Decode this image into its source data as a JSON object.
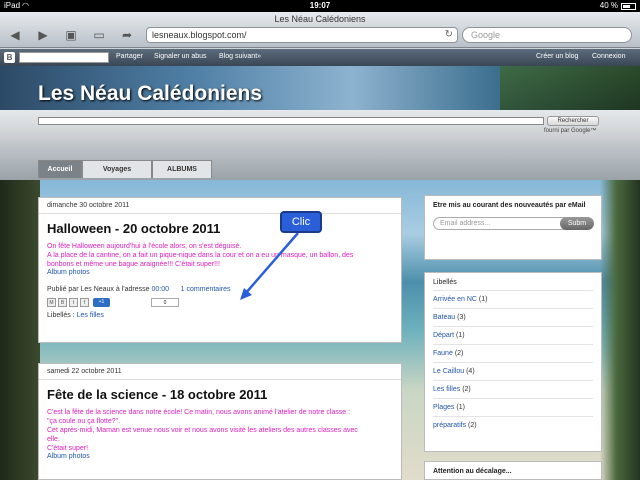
{
  "status_bar": {
    "carrier": "iPad",
    "time": "19:07",
    "battery": "40 %"
  },
  "browser": {
    "page_title": "Les Néau Calédoniens",
    "url": "lesneaux.blogspot.com/",
    "search_placeholder": "Google"
  },
  "navbar": {
    "logo": "B",
    "share": "Partager",
    "report": "Signaler un abus",
    "next_blog": "Blog suivant»",
    "create_blog": "Créer un blog",
    "signin": "Connexion"
  },
  "header": {
    "blog_title": "Les Néau Calédoniens",
    "search_button": "Rechercher",
    "search_credit": "fourni par Google™"
  },
  "tabs": [
    {
      "label": "Accueil",
      "active": true
    },
    {
      "label": "Voyages",
      "active": false
    },
    {
      "label": "ALBUMS",
      "active": false
    }
  ],
  "posts": [
    {
      "date": "dimanche 30 octobre 2011",
      "title": "Halloween - 20 octobre 2011",
      "body": [
        "On fête Halloween aujourd'hui à l'école alors, on s'est déguisé.",
        "A la place de la cantine, on a fait un pique-nique dans la cour et on a eu un masque, un ballon, des",
        "bonbons et même une bague araignée!!! C'était super!!!"
      ],
      "album": "Album photos",
      "posted_by": "Publié par Les Neaux à l'adresse",
      "time": "00:00",
      "comments": "1 commentaires",
      "share_count": "0",
      "labels_prefix": "Libellés :",
      "label": "Les filles"
    },
    {
      "date": "samedi 22 octobre 2011",
      "title": "Fête de la science - 18 octobre 2011",
      "body": [
        "C'est la fête de la science dans notre école! Ce matin, nous avons animé l'atelier de notre classe :",
        "\"ça coule ou ça flotte?\".",
        "Cet après-midi, Maman est venue nous voir et nous avons visité les ateliers des autres classes avec",
        "elle.",
        "C'était super!"
      ],
      "album": "Album photos"
    }
  ],
  "annotation": {
    "bubble": "Clic"
  },
  "sidebar": {
    "subscribe": {
      "title": "Etre mis au courant des nouveautés par eMail",
      "email_placeholder": "Email address...",
      "submit": "Subm"
    },
    "labels": {
      "title": "Libellés",
      "items": [
        {
          "name": "Arrivée en NC",
          "count": "(1)"
        },
        {
          "name": "Bateau",
          "count": "(3)"
        },
        {
          "name": "Départ",
          "count": "(1)"
        },
        {
          "name": "Faune",
          "count": "(2)"
        },
        {
          "name": "Le Caillou",
          "count": "(4)"
        },
        {
          "name": "Les filles",
          "count": "(2)"
        },
        {
          "name": "Plages",
          "count": "(1)"
        },
        {
          "name": "préparatifs",
          "count": "(2)"
        }
      ]
    },
    "attention": {
      "title": "Attention au décalage..."
    }
  }
}
